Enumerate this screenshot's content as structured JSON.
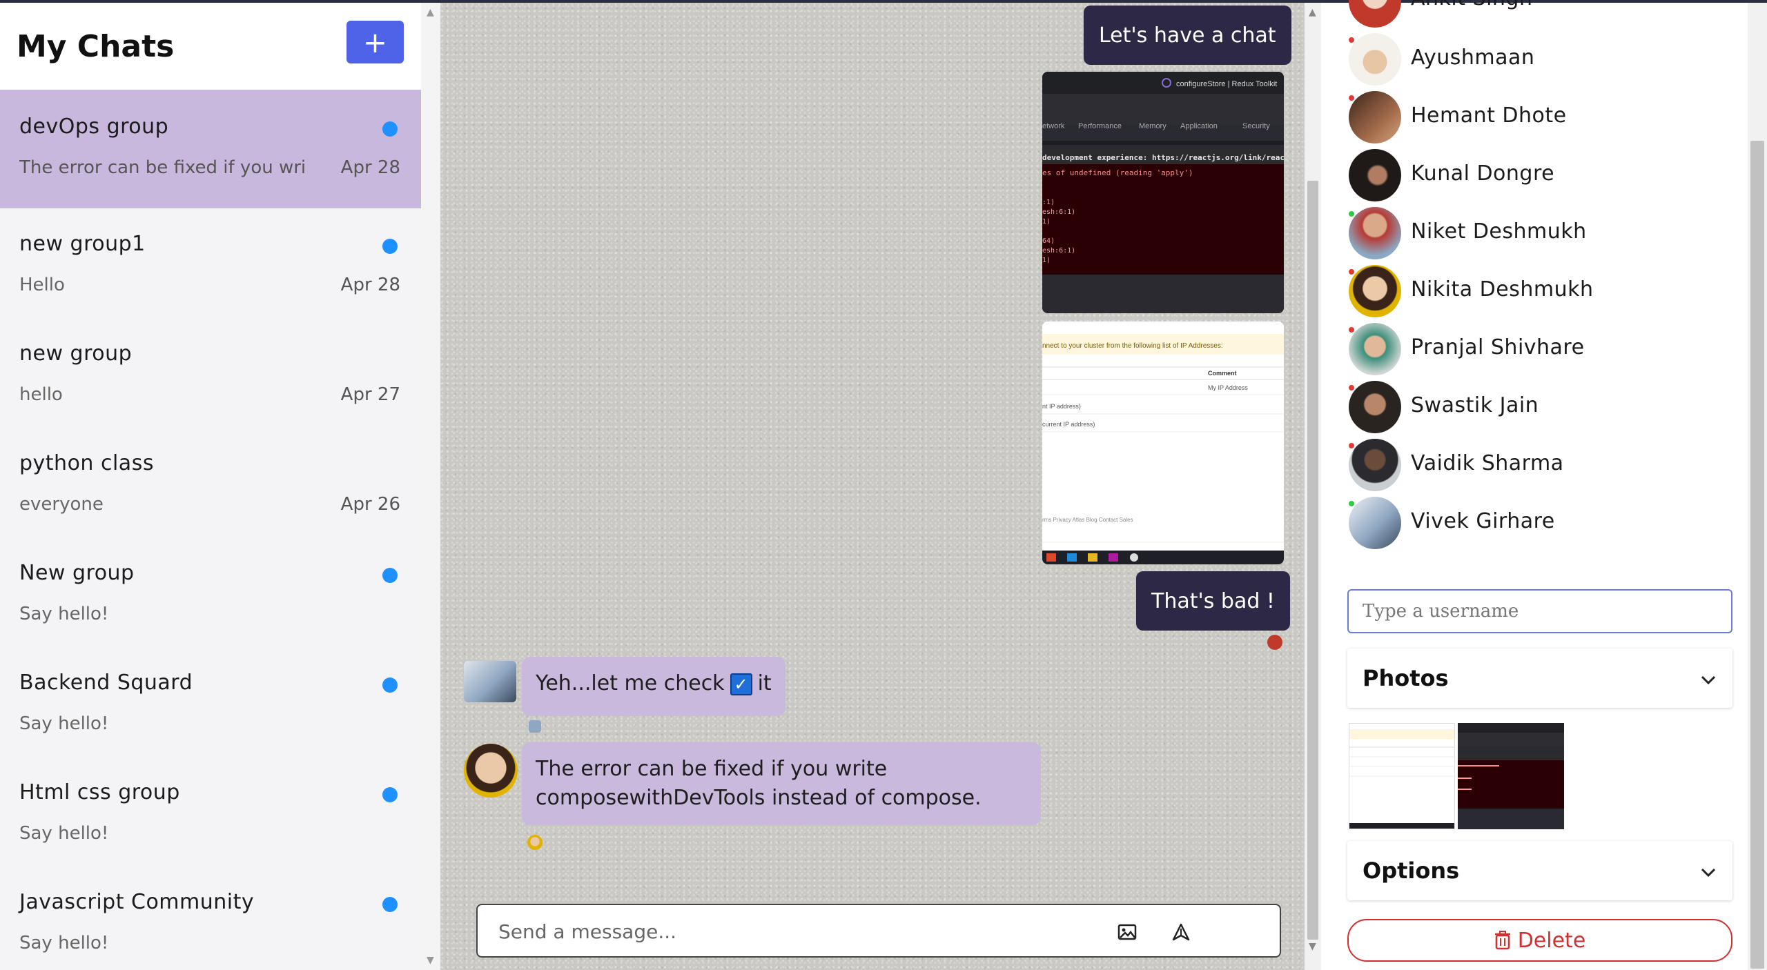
{
  "sidebar": {
    "title": "My Chats",
    "new_chat_button": "+",
    "chats": [
      {
        "name": "devOps group",
        "preview": "The error can be fixed if you wri",
        "date": "Apr 28",
        "unread": true,
        "active": true
      },
      {
        "name": "new group1",
        "preview": "Hello",
        "date": "Apr 28",
        "unread": true,
        "active": false
      },
      {
        "name": "new group",
        "preview": "hello",
        "date": "Apr 27",
        "unread": false,
        "active": false
      },
      {
        "name": "python class",
        "preview": "everyone",
        "date": "Apr 26",
        "unread": false,
        "active": false
      },
      {
        "name": "New group",
        "preview": "Say hello!",
        "date": "",
        "unread": true,
        "active": false
      },
      {
        "name": "Backend Squard",
        "preview": "Say hello!",
        "date": "",
        "unread": true,
        "active": false
      },
      {
        "name": "Html css group",
        "preview": "Say hello!",
        "date": "",
        "unread": true,
        "active": false
      },
      {
        "name": "Javascript Community",
        "preview": "Say hello!",
        "date": "",
        "unread": true,
        "active": false
      }
    ]
  },
  "chat": {
    "messages": {
      "sent_1": "Let's have a chat",
      "screenshot_1": {
        "title": "configureStore | Redux Toolkit",
        "tabs": [
          "etwork",
          "Performance",
          "Memory",
          "Application",
          "Security"
        ],
        "console_line_1": "development experience: https://reactjs.org/link/react-",
        "console_line_2": "es of undefined (reading 'apply')",
        "console_lines": [
          ":1)",
          "esh:6:1)",
          "1)",
          "64)",
          "esh:6:1)",
          "1)"
        ]
      },
      "screenshot_2": {
        "banner": "nnect to your cluster from the following list of IP Addresses:",
        "column_header": "Comment",
        "row_1": "My IP Address",
        "row_2": "nt IP address)",
        "row_3": "current IP address)",
        "footer": "rms   Privacy   Atlas Blog   Contact Sales"
      },
      "sent_2": "That's bad !",
      "recv_1_before": "Yeh...let me check",
      "recv_1_emoji": "✓",
      "recv_1_after": "it",
      "recv_2": "The error can be fixed if you write composewithDevTools instead of compose."
    },
    "composer": {
      "placeholder": "Send a message...",
      "image_icon": "image-icon",
      "send_icon": "send-icon"
    }
  },
  "members": [
    {
      "name": "Ankit Singh",
      "online": false,
      "color": "#c0392b"
    },
    {
      "name": "Ayushmaan",
      "online": false,
      "color": "#d8d2c4"
    },
    {
      "name": "Hemant Dhote",
      "online": false,
      "color": "#6b4a3a"
    },
    {
      "name": "Kunal Dongre",
      "online": false,
      "color": "#1f1a18"
    },
    {
      "name": "Niket Deshmukh",
      "online": true,
      "color": "#b73a33"
    },
    {
      "name": "Nikita Deshmukh",
      "online": false,
      "color": "#e0b400"
    },
    {
      "name": "Pranjal Shivhare",
      "online": false,
      "color": "#3d8e7a"
    },
    {
      "name": "Swastik Jain",
      "online": false,
      "color": "#2a2421"
    },
    {
      "name": "Vaidik Sharma",
      "online": false,
      "color": "#9fa6ab"
    },
    {
      "name": "Vivek Girhare",
      "online": true,
      "color": "#8fa7c2"
    }
  ],
  "right_panel": {
    "search_placeholder": "Type a username",
    "photos_title": "Photos",
    "options_title": "Options",
    "delete_label": "Delete"
  },
  "colors": {
    "accent": "#4f63e8",
    "active_chat": "#c8b8dd",
    "unread_dot": "#1e90ff",
    "sent_bubble": "#2e2847",
    "recv_bubble": "#c9b9dd",
    "danger": "#d32f2f",
    "status_online": "#2ecc40",
    "status_offline": "#e53935"
  }
}
